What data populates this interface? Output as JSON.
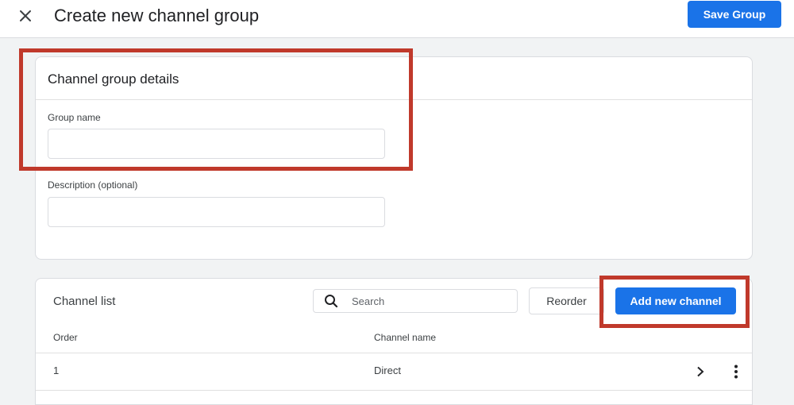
{
  "header": {
    "title": "Create new channel group",
    "save_label": "Save Group",
    "close_icon": "close-icon"
  },
  "details": {
    "title": "Channel group details",
    "group_name_label": "Group name",
    "group_name_value": "",
    "description_label": "Description (optional)",
    "description_value": ""
  },
  "channel_list": {
    "title": "Channel list",
    "search_placeholder": "Search",
    "search_icon": "search-icon",
    "reorder_label": "Reorder",
    "add_label": "Add new channel",
    "columns": [
      "Order",
      "Channel name"
    ],
    "rows": [
      {
        "order": "1",
        "name": "Direct"
      }
    ]
  },
  "colors": {
    "primary": "#1a73e8",
    "annotation": "#c0392b",
    "background": "#f1f3f4"
  }
}
